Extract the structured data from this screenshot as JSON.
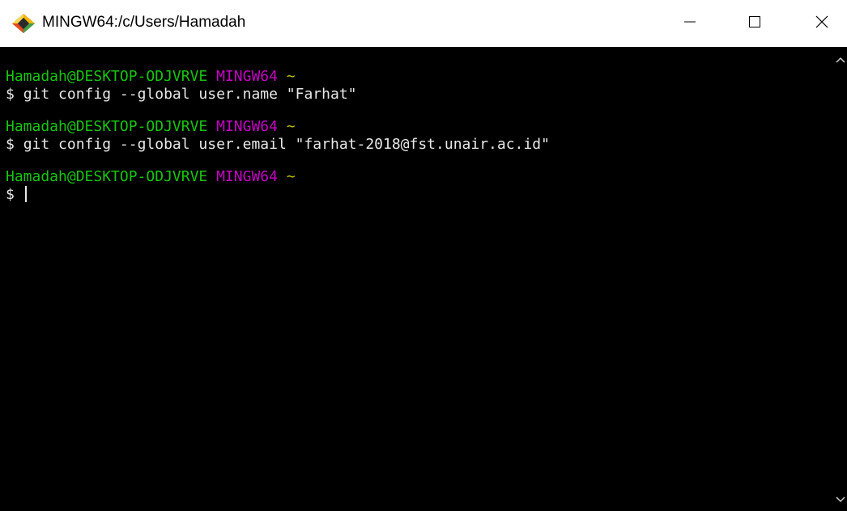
{
  "window": {
    "title": "MINGW64:/c/Users/Hamadah",
    "app_icon": "git-bash-icon",
    "controls": {
      "minimize_icon": "minimize-icon",
      "maximize_icon": "maximize-icon",
      "close_icon": "close-icon"
    }
  },
  "terminal": {
    "blocks": [
      {
        "user_host": "Hamadah@DESKTOP-ODJVRVE",
        "env": "MINGW64",
        "path": "~",
        "prompt": "$",
        "command": "git config --global user.name \"Farhat\""
      },
      {
        "user_host": "Hamadah@DESKTOP-ODJVRVE",
        "env": "MINGW64",
        "path": "~",
        "prompt": "$",
        "command": "git config --global user.email \"farhat-2018@fst.unair.ac.id\""
      },
      {
        "user_host": "Hamadah@DESKTOP-ODJVRVE",
        "env": "MINGW64",
        "path": "~",
        "prompt": "$",
        "command": ""
      }
    ]
  },
  "colors": {
    "background": "#000000",
    "user_host": "#16c60c",
    "env": "#c600c6",
    "path": "#c1c100",
    "text": "#e8e8e8"
  },
  "scrollbar": {
    "up_icon": "scroll-up-arrow-icon",
    "down_icon": "scroll-down-arrow-icon"
  }
}
